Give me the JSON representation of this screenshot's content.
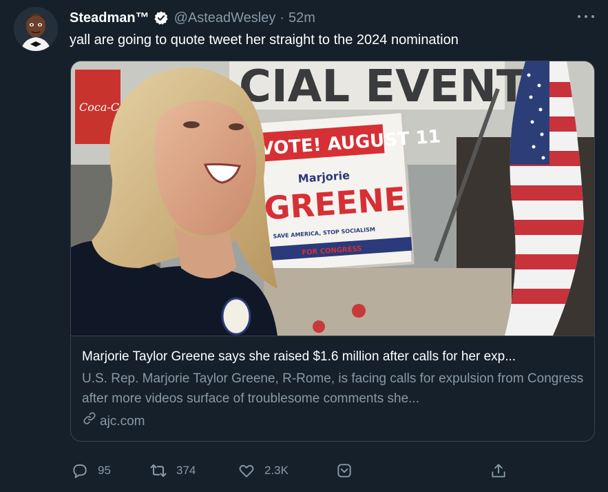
{
  "tweet": {
    "display_name": "Steadman™",
    "handle": "@AsteadWesley",
    "separator": "·",
    "timestamp": "52m",
    "text": "yall are going to quote tweet her straight to the 2024 nomination"
  },
  "card": {
    "image_signs": {
      "banner": "CIAL EVENTS",
      "brand": "Coca-Cola",
      "sign_date": "VOTE! AUGUST 11",
      "sign_first": "Marjorie",
      "sign_last": "GREENE",
      "sign_slogan": "SAVE AMERICA, STOP SOCIALISM",
      "sign_for": "FOR CONGRESS"
    },
    "title": "Marjorie Taylor Greene says she raised $1.6 million after calls for her exp...",
    "description": "U.S. Rep. Marjorie Taylor Greene, R-Rome, is facing calls for expulsion from Congress after more videos surface of troublesome comments she...",
    "domain": "ajc.com"
  },
  "actions": {
    "reply_count": "95",
    "retweet_count": "374",
    "like_count": "2.3K"
  },
  "icons": [
    "verified-badge-icon",
    "more-icon",
    "link-icon",
    "reply-icon",
    "retweet-icon",
    "like-icon",
    "bookmark-icon",
    "share-icon"
  ],
  "colors": {
    "background": "#15202b",
    "secondary_text": "#8899a6",
    "border": "#38444d"
  }
}
